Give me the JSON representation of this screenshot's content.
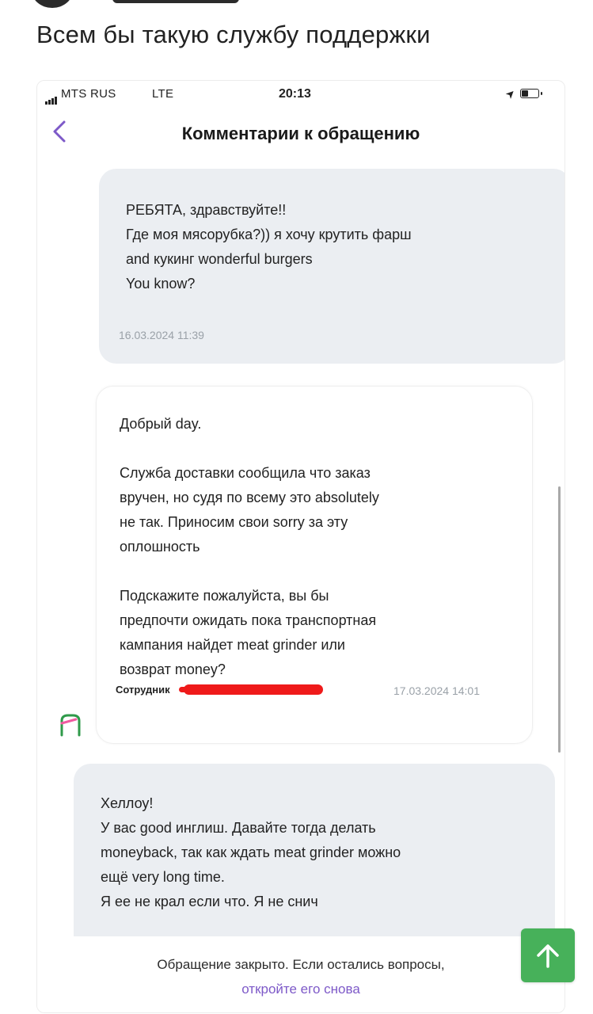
{
  "post": {
    "title": "Всем бы такую службу поддержки"
  },
  "status_bar": {
    "carrier": "MTS RUS",
    "network": "LTE",
    "time": "20:13",
    "icons": [
      "signal-icon",
      "location-icon",
      "battery-icon"
    ]
  },
  "screen": {
    "title": "Комментарии к обращению",
    "back_icon": "chevron-left-icon"
  },
  "messages": [
    {
      "author": "user",
      "text": "РЕБЯТА, здравствуйте!!\nГде моя мясорубка?)) я хочу крутить фарш\nand кукинг wonderful burgers\nYou know?",
      "timestamp": "16.03.2024 11:39"
    },
    {
      "author": "agent",
      "text": "Добрый day.\n\nСлужба доставки сообщила что заказ\nвручен, но судя по всему это absolutely\nне так. Приносим свои sorry за эту\nоплошность\n\nПодскажите пожалуйста, вы бы\nпредпочти ожидать пока транспортная\nкампания найдет meat grinder или\nвозврат money?",
      "author_label": "Сотрудник",
      "timestamp": "17.03.2024 14:01"
    },
    {
      "author": "user",
      "text": "Хеллоу!\nУ вас good инглиш. Давайте тогда делать\nmoneyback, так как ждать meat grinder можно\nещё very long time.\nЯ ее не крал если что. Я не снич"
    }
  ],
  "footer": {
    "closed_text": "Обращение закрыто. Если остались вопросы,",
    "reopen_link": "откройте его снова"
  },
  "colors": {
    "accent": "#7d59c8",
    "user_bubble": "#ebeef2",
    "redaction": "#ef1a1a",
    "scroll_button": "#47b15a"
  }
}
